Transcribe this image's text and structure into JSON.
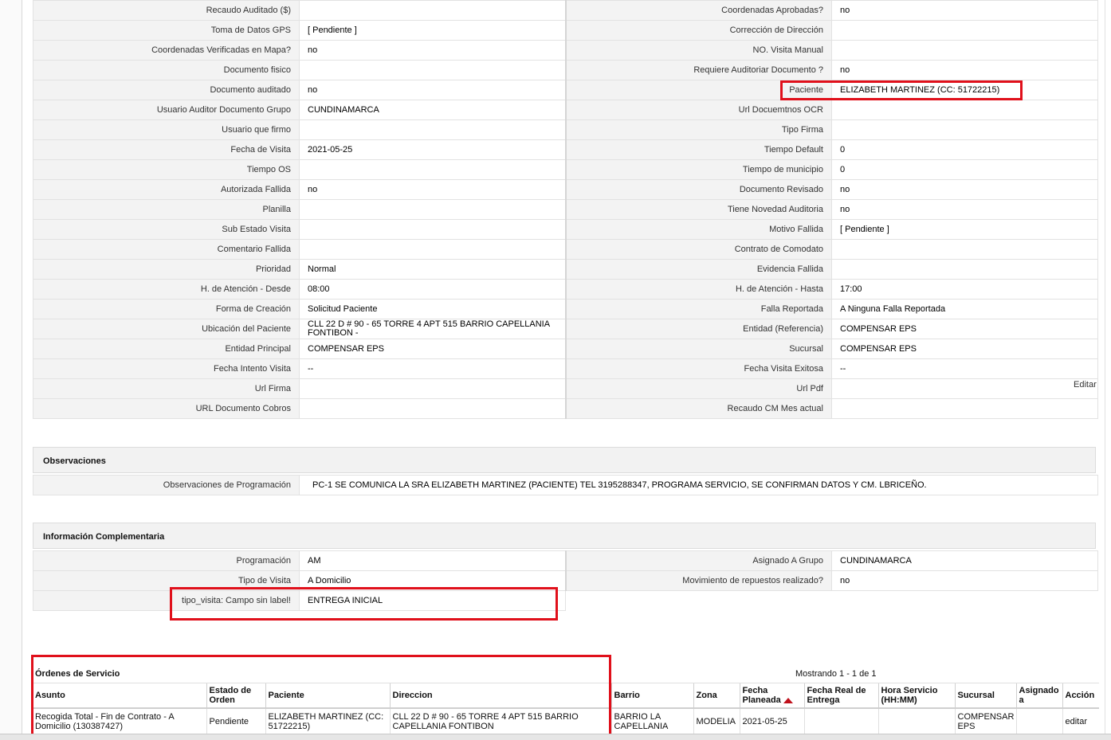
{
  "fields": [
    {
      "l1": "Recaudo Auditado ($)",
      "v1": "",
      "l2": "Coordenadas Aprobadas?",
      "v2": "no"
    },
    {
      "l1": "Toma de Datos GPS",
      "v1": "[ Pendiente ]",
      "l2": "Corrección de Dirección",
      "v2": ""
    },
    {
      "l1": "Coordenadas Verificadas en Mapa?",
      "v1": "no",
      "l2": "NO. Visita Manual",
      "v2": ""
    },
    {
      "l1": "Documento fisico",
      "v1": "",
      "l2": "Requiere Auditoriar Documento ?",
      "v2": "no"
    },
    {
      "l1": "Documento auditado",
      "v1": "no",
      "l2": "Paciente",
      "v2": "ELIZABETH MARTINEZ (CC: 51722215)"
    },
    {
      "l1": "Usuario Auditor Documento Grupo",
      "v1": "CUNDINAMARCA",
      "l2": "Url Docuemtnos OCR",
      "v2": ""
    },
    {
      "l1": "Usuario que firmo",
      "v1": "",
      "l2": "Tipo Firma",
      "v2": ""
    },
    {
      "l1": "Fecha de Visita",
      "v1": "2021-05-25",
      "l2": "Tiempo Default",
      "v2": "0"
    },
    {
      "l1": "Tiempo OS",
      "v1": "",
      "l2": "Tiempo de municipio",
      "v2": "0"
    },
    {
      "l1": "Autorizada Fallida",
      "v1": "no",
      "l2": "Documento Revisado",
      "v2": "no"
    },
    {
      "l1": "Planilla",
      "v1": "",
      "l2": "Tiene Novedad Auditoria",
      "v2": "no"
    },
    {
      "l1": "Sub Estado Visita",
      "v1": "",
      "l2": "Motivo Fallida",
      "v2": "[ Pendiente ]"
    },
    {
      "l1": "Comentario Fallida",
      "v1": "",
      "l2": "Contrato de Comodato",
      "v2": ""
    },
    {
      "l1": "Prioridad",
      "v1": "Normal",
      "l2": "Evidencia Fallida",
      "v2": ""
    },
    {
      "l1": "H. de Atención - Desde",
      "v1": "08:00",
      "l2": "H. de Atención - Hasta",
      "v2": "17:00"
    },
    {
      "l1": "Forma de Creación",
      "v1": "Solicitud Paciente",
      "l2": "Falla Reportada",
      "v2": "A Ninguna Falla Reportada"
    },
    {
      "l1": "Ubicación del Paciente",
      "v1": "CLL 22 D # 90 - 65 TORRE 4 APT 515 BARRIO CAPELLANIA FONTIBON -",
      "l2": "Entidad (Referencia)",
      "v2": "COMPENSAR EPS"
    },
    {
      "l1": "Entidad Principal",
      "v1": "COMPENSAR EPS",
      "l2": "Sucursal",
      "v2": "COMPENSAR EPS"
    },
    {
      "l1": "Fecha Intento Visita",
      "v1": "--",
      "l2": "Fecha Visita Exitosa",
      "v2": "--"
    },
    {
      "l1": "Url Firma",
      "v1": "",
      "l2": "Url Pdf",
      "v2": ""
    },
    {
      "l1": "URL Documento Cobros",
      "v1": "",
      "l2": "Recaudo CM Mes actual",
      "v2": ""
    }
  ],
  "edit_label": "Editar",
  "observations": {
    "title": "Observaciones",
    "label": "Observaciones de Programación",
    "value": "PC-1 SE COMUNICA LA SRA ELIZABETH MARTINEZ (PACIENTE) TEL 3195288347, PROGRAMA SERVICIO, SE CONFIRMAN DATOS Y CM. LBRICEÑO."
  },
  "complementary": {
    "title": "Información Complementaria",
    "rows": [
      {
        "l1": "Programación",
        "v1": "AM",
        "l2": "Asignado A Grupo",
        "v2": "CUNDINAMARCA"
      },
      {
        "l1": "Tipo de Visita",
        "v1": "A Domicilio",
        "l2": "Movimiento de repuestos realizado?",
        "v2": "no"
      },
      {
        "l1": "tipo_visita: Campo sin label!",
        "v1": "ENTREGA INICIAL",
        "l2": "",
        "v2": ""
      }
    ]
  },
  "orders": {
    "title": "Órdenes de Servicio",
    "showing": "Mostrando 1 - 1 de 1",
    "columns": [
      "Asunto",
      "Estado de Orden",
      "Paciente",
      "Direccion",
      "Barrio",
      "Zona",
      "Fecha Planeada",
      "Fecha Real de Entrega",
      "Hora Servicio (HH:MM)",
      "Sucursal",
      "Asignado a",
      "Acción"
    ],
    "rows": [
      {
        "asunto": "Recogida Total - Fin de Contrato - A Domicilio (130387427)",
        "estado": "Pendiente",
        "paciente": "ELIZABETH MARTINEZ (CC: 51722215)",
        "direccion": "CLL 22 D # 90 - 65 TORRE 4 APT 515 BARRIO CAPELLANIA FONTIBON",
        "barrio": "BARRIO LA CAPELLANIA",
        "zona": "MODELIA",
        "fecha_planeada": "2021-05-25",
        "fecha_real": "",
        "hora": "",
        "sucursal": "COMPENSAR EPS",
        "asignado": "",
        "accion": "editar"
      }
    ]
  },
  "colors": {
    "highlight": "#e0101b",
    "label_bg": "#f3f3f3",
    "border": "#e2e2e2"
  }
}
